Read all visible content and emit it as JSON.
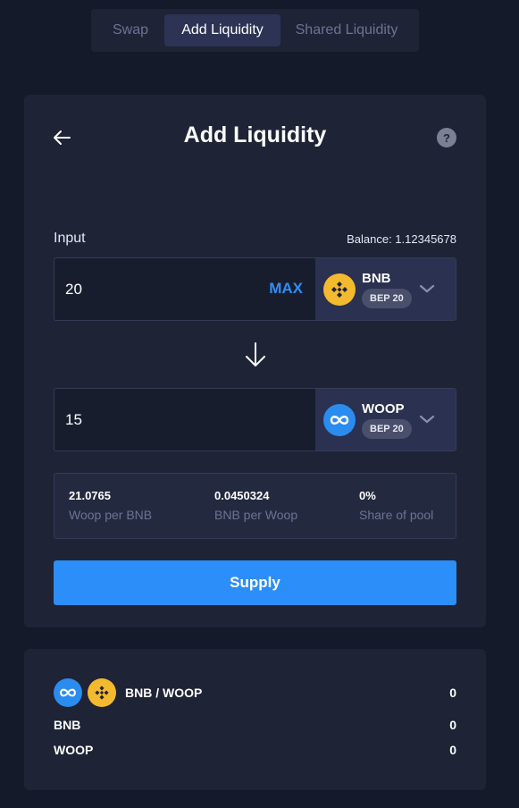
{
  "tabs": [
    {
      "label": "Swap",
      "active": false
    },
    {
      "label": "Add Liquidity",
      "active": true
    },
    {
      "label": "Shared Liquidity",
      "active": false
    }
  ],
  "card": {
    "title": "Add Liquidity",
    "help_label": "?",
    "input_label": "Input",
    "balance_text": "Balance: 1.12345678"
  },
  "input1": {
    "value": "20",
    "max_label": "MAX",
    "token": "BNB",
    "badge": "BEP 20",
    "icon": "bnb-icon"
  },
  "input2": {
    "value": "15",
    "token": "WOOP",
    "badge": "BEP 20",
    "icon": "woop-icon"
  },
  "stats": [
    {
      "value": "21.0765",
      "label": "Woop per BNB"
    },
    {
      "value": "0.0450324",
      "label": "BNB per Woop"
    },
    {
      "value": "0%",
      "label": "Share of pool"
    }
  ],
  "supply_label": "Supply",
  "pool": {
    "pair": "BNB / WOOP",
    "pair_value": "0",
    "lines": [
      {
        "label": "BNB",
        "value": "0"
      },
      {
        "label": "WOOP",
        "value": "0"
      }
    ]
  },
  "colors": {
    "accent": "#2c8ef8",
    "bnb": "#f3ba2f",
    "woop": "#2b8cf0",
    "background": "#151a2a",
    "card": "#1e2336"
  }
}
